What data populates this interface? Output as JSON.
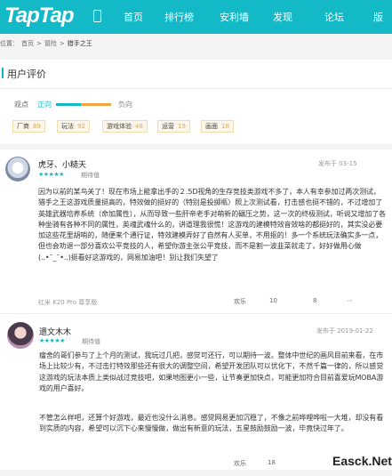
{
  "header": {
    "logo": "TapTap",
    "nav": [
      "首页",
      "排行榜",
      "安利墙",
      "发现",
      "论坛",
      "版"
    ]
  },
  "breadcrumb": [
    "位置：",
    "首页",
    ">",
    "冒险",
    ">",
    "猎手之王"
  ],
  "section": {
    "title": "用户评价"
  },
  "sentiment": {
    "label": "观点",
    "positive": "正向",
    "negative": "负向"
  },
  "tags": [
    {
      "name": "厂商",
      "count": "89"
    },
    {
      "name": "玩法",
      "count": "92"
    },
    {
      "name": "游戏体验",
      "count": "48"
    },
    {
      "name": "运营",
      "count": "19"
    },
    {
      "name": "画面",
      "count": "18"
    }
  ],
  "reviews": [
    {
      "user": "虎牙、小糙天",
      "stars": "★★★★★",
      "play_status": "期待值",
      "date": "发布于 03-15",
      "text": "因为以前的某鸟关了！现在市场上能拿出手的２.5D视角的生存竞技类游戏不多了，本人有幸参加过两次测试，猎手之王这游戏质量挺高的，特效做的挺好的（特别是投掷瓶）照上次测试看，打击感也挺不错的，不过增加了英雄武器培养系统（命加属性），从而导致一些肝帝老手对萌新的碾压之势，这一次的终极测试，听说又增加了各种坐骑有各种不同的属性，英魂武魂什么的，讲道理我很慌！这游戏的建模特效音效啥的都挺好的，其实没必要加这些花里胡哨的，随便来个通行证，特效建模弄好了自然有人买单，不用抠的！多一个系统玩法确实多一点，但也会劝退一部分喜欢公平竞技的人，希望你游主张公平竞技，而不是割一波韭菜就走了，好好做用心做(..•˘_˘•..)挺看好这游戏的，网易加油吧！别让我们失望了",
      "device": "红米 K20 Pro 尊享版",
      "like": "欢乐",
      "like_count": "10",
      "comment_count": "8"
    },
    {
      "user": "遗文木木",
      "stars": "★★★★★",
      "play_status": "期待值",
      "date": "发布于 2019-01-22",
      "text": "瘤舍的哥们参与了上个月的测试，我玩过几把，感觉可还行，可以期待一波。整体中世纪的画风目前来看，在市场上比较少有，不过击打特效那些还有很大的调整空间，希望开发团队可以优化下，不然千篇一律的，所以感觉这游戏的玩法本质上类似战过竞技吧，如果地图更小一些，让节奏更加快点，可能更加符合目前喜爱玩MOBA游戏的用户喜好。",
      "text2": "不管怎么样吧，还算个好游戏，最近也没什么消息。感觉网易更加沉稳了，不像之前哗哩哗啦一大堆，却没有看到实质的内容，希望可以沉下心来慢慢做，做出有新意的玩法，五星鼓励鼓励一波，毕竟快过年了。",
      "like": "欢乐",
      "like_count": "18"
    }
  ],
  "watermark": "Easck.Net"
}
